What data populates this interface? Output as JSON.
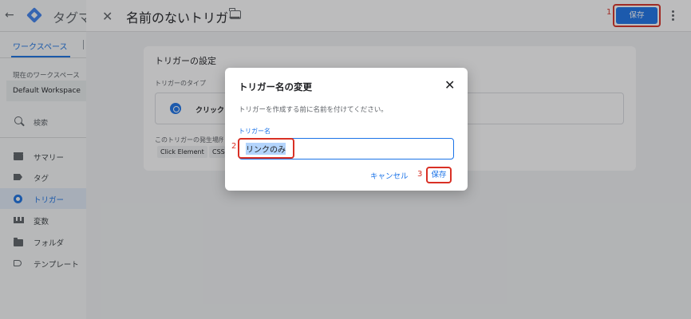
{
  "app": {
    "back_label": "←",
    "name": "タグマネージャー"
  },
  "left_panel": {
    "workspace_tab": "ワークスペース",
    "current_workspace_label": "現在のワークスペース",
    "current_workspace_value": "Default Workspace",
    "search_label": "検索",
    "nav": [
      {
        "label": "サマリー",
        "icon": "summary-icon",
        "active": false
      },
      {
        "label": "タグ",
        "icon": "tag-icon",
        "active": false
      },
      {
        "label": "トリガー",
        "icon": "trigger-icon",
        "active": true
      },
      {
        "label": "変数",
        "icon": "variable-icon",
        "active": false
      },
      {
        "label": "フォルダ",
        "icon": "folder-icon",
        "active": false
      },
      {
        "label": "テンプレート",
        "icon": "template-icon",
        "active": false
      }
    ]
  },
  "editor": {
    "close_label": "✕",
    "title": "名前のないトリガー",
    "save_label": "保存",
    "step1": "1"
  },
  "card": {
    "title": "トリガーの設定",
    "trigger_type_label": "トリガーのタイプ",
    "trigger_type_value": "クリック",
    "fires_on_label": "このトリガーの発生場所",
    "chips": [
      "Click Element",
      "CSS"
    ]
  },
  "dialog": {
    "title": "トリガー名の変更",
    "close_label": "✕",
    "description": "トリガーを作成する前に名前を付けてください。",
    "field_label": "トリガー名",
    "field_value": "リンクのみ",
    "cancel_label": "キャンセル",
    "save_label": "保存",
    "step2": "2",
    "step3": "3"
  },
  "colors": {
    "accent": "#1a73e8",
    "highlight": "#d93025"
  }
}
